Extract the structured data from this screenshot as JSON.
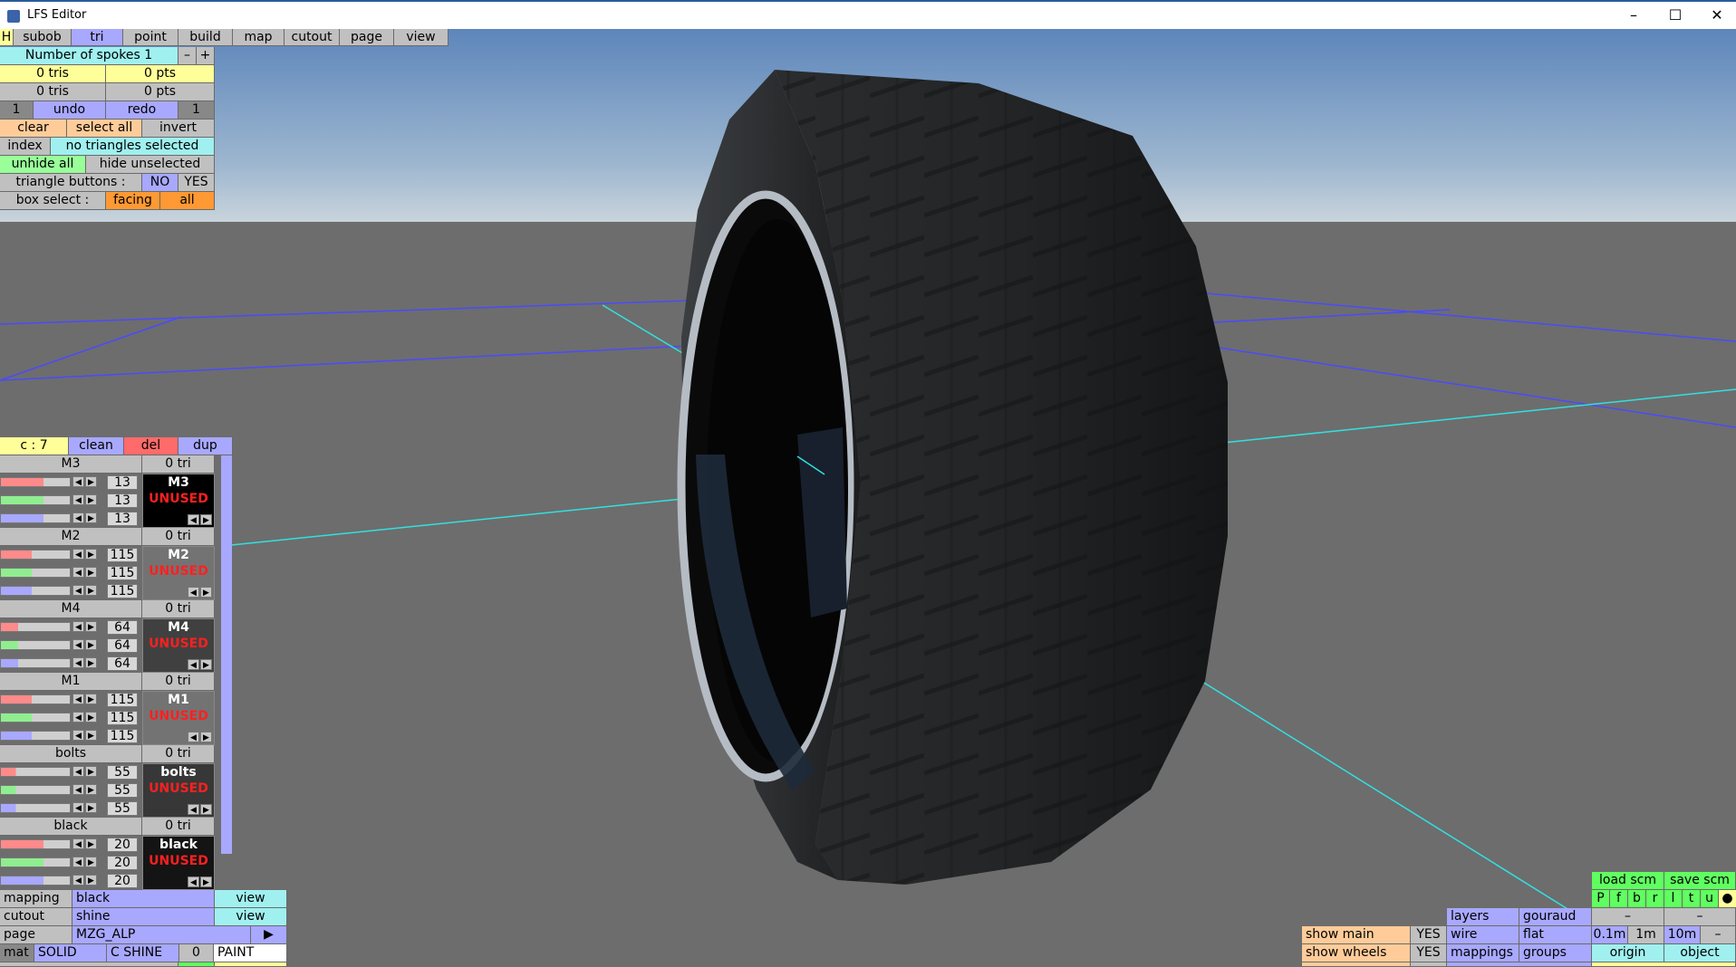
{
  "window": {
    "title": "LFS Editor",
    "minimize": "–",
    "maximize": "☐",
    "close": "✕"
  },
  "menu": {
    "h": "H",
    "tabs": [
      "subob",
      "tri",
      "point",
      "build",
      "map",
      "cutout",
      "page",
      "view"
    ]
  },
  "tri_panel": {
    "spokes_label": "Number of spokes 1",
    "minus": "–",
    "plus": "+",
    "tris1": "0 tris",
    "pts1": "0 pts",
    "tris2": "0 tris",
    "pts2": "0 pts",
    "undo_count": "1",
    "undo": "undo",
    "redo": "redo",
    "redo_count": "1",
    "clear": "clear",
    "select_all": "select all",
    "invert": "invert",
    "index": "index",
    "no_selection": "no triangles selected",
    "unhide_all": "unhide all",
    "hide_unselected": "hide unselected",
    "tri_buttons_label": "triangle buttons :",
    "no": "NO",
    "yes": "YES",
    "box_select_label": "box select :",
    "facing": "facing",
    "all": "all"
  },
  "materials": {
    "count": "c : 7",
    "clean": "clean",
    "del": "del",
    "dup": "dup",
    "items": [
      {
        "name": "M3",
        "tri": "0 tri",
        "v1": "13",
        "v2": "13",
        "v3": "13",
        "preview": "M3",
        "status": "UNUSED",
        "r": 0.62,
        "g": 0.62,
        "b": 0.62,
        "a": 0.62,
        "bg": "#000000",
        "fg": "#ffffff"
      },
      {
        "name": "M2",
        "tri": "0 tri",
        "v1": "115",
        "v2": "115",
        "v3": "115",
        "preview": "M2",
        "status": "UNUSED",
        "r": 0.45,
        "g": 0.45,
        "b": 0.45,
        "a": 0.45,
        "bg": "#737373",
        "fg": "#ffffff"
      },
      {
        "name": "M4",
        "tri": "0 tri",
        "v1": "64",
        "v2": "64",
        "v3": "64",
        "preview": "M4",
        "status": "UNUSED",
        "r": 0.25,
        "g": 0.25,
        "b": 0.25,
        "a": 0.25,
        "bg": "#404040",
        "fg": "#ffffff"
      },
      {
        "name": "M1",
        "tri": "0 tri",
        "v1": "115",
        "v2": "115",
        "v3": "115",
        "preview": "M1",
        "status": "UNUSED",
        "r": 0.45,
        "g": 0.45,
        "b": 0.45,
        "a": 0.45,
        "bg": "#737373",
        "fg": "#ffffff"
      },
      {
        "name": "bolts",
        "tri": "0 tri",
        "v1": "55",
        "v2": "55",
        "v3": "55",
        "preview": "bolts",
        "status": "UNUSED",
        "r": 0.22,
        "g": 0.22,
        "b": 0.22,
        "a": 0.22,
        "bg": "#373737",
        "fg": "#ffffff"
      },
      {
        "name": "black",
        "tri": "0 tri",
        "v1": "20",
        "v2": "20",
        "v3": "20",
        "preview": "black",
        "status": "UNUSED",
        "r": 0.62,
        "g": 0.62,
        "b": 0.62,
        "a": 0.62,
        "bg": "#141414",
        "fg": "#ffffff"
      }
    ]
  },
  "props": {
    "mapping_label": "mapping",
    "mapping_value": "black",
    "mapping_view": "view",
    "cutout_label": "cutout",
    "cutout_value": "shine",
    "cutout_view": "view",
    "page_label": "page",
    "page_value": "MZG_ALP",
    "page_arrow": "▶",
    "mat_label": "mat",
    "solid": "SOLID",
    "cshine": "C SHINE",
    "zero": "0",
    "paint": "PAINT"
  },
  "bottom_right": {
    "load_scm": "load scm",
    "save_scm": "save scm",
    "flags": [
      "P",
      "f",
      "b",
      "r",
      "l",
      "t",
      "u",
      "●"
    ],
    "layers": "layers",
    "gouraud": "gouraud",
    "dash1": "–",
    "dash2": "–",
    "show_main": "show main",
    "show_main_val": "YES",
    "wire": "wire",
    "flat": "flat",
    "g01": "0.1m",
    "g1": "1m",
    "g10": "10m",
    "gdash": "–",
    "show_wheels": "show wheels",
    "show_wheels_val": "YES",
    "mappings": "mappings",
    "groups": "groups",
    "origin": "origin",
    "object": "object"
  }
}
